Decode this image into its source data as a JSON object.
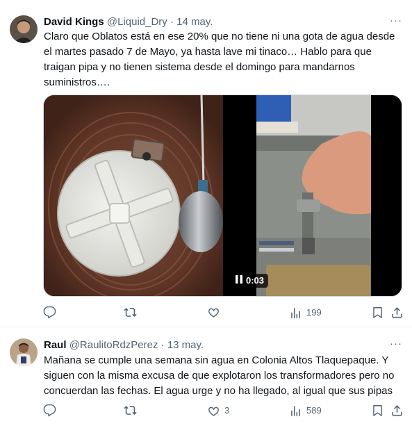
{
  "tweets": [
    {
      "author_name": "David Kings",
      "handle": "@Liquid_Dry",
      "separator": "·",
      "date": "14 may.",
      "more_label": "···",
      "text": "Claro que Oblatos está en ese 20% que no tiene ni una gota de agua desde el martes pasado 7 de Mayo, ya hasta lave mi tinaco… Hablo para que traigan pipa y no tienen sistema desde el domingo para mandarnos suministros….",
      "video_time": "0:03",
      "stats": {
        "replies": "",
        "retweets": "",
        "likes": "",
        "views": "199"
      }
    },
    {
      "author_name": "Raul",
      "handle": "@RaulitoRdzPerez",
      "separator": "·",
      "date": "13 may.",
      "more_label": "···",
      "text": "Mañana se cumple una semana sin agua en Colonia Altos Tlaquepaque. Y siguen con la misma excusa de que explotaron los transformadores pero no concuerdan las fechas. El agua urge y no ha llegado, al igual que sus pipas",
      "stats": {
        "replies": "",
        "retweets": "",
        "likes": "3",
        "views": "589"
      }
    }
  ],
  "icons": {
    "reply": "reply-icon",
    "retweet": "retweet-icon",
    "like": "heart-icon",
    "views": "views-icon",
    "bookmark": "bookmark-icon",
    "share": "share-icon",
    "more": "more-icon",
    "pause": "pause-icon"
  },
  "colors": {
    "text": "#0f1419",
    "secondary": "#536471",
    "border": "#eff3f4"
  }
}
